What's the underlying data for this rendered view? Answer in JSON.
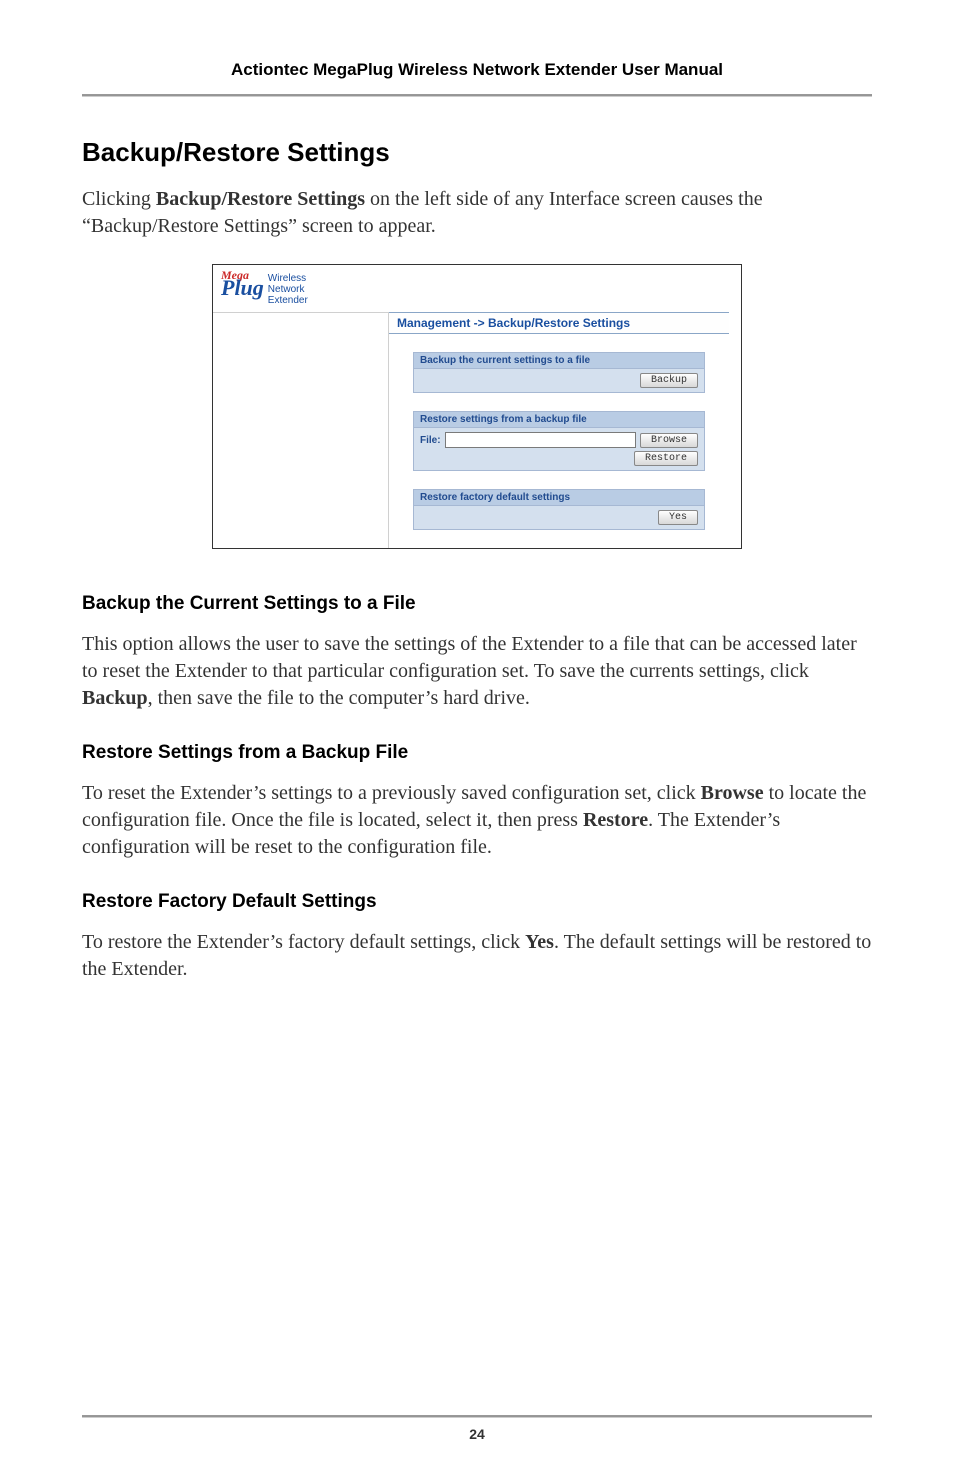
{
  "header": {
    "title": "Actiontec MegaPlug Wireless Network Extender User Manual"
  },
  "section": {
    "title": "Backup/Restore Settings",
    "intro_a": "Clicking ",
    "intro_bold": "Backup/Restore Settings",
    "intro_b": " on the left side of any Interface screen causes the “Backup/Restore Settings” screen to appear."
  },
  "screenshot": {
    "logo_mega": "Mega",
    "logo_plug": "Plug",
    "logo_sub1": "Wireless",
    "logo_sub2": "Network",
    "logo_sub3": "Extender",
    "breadcrumb": "Management -> Backup/Restore Settings",
    "panel1_title": "Backup the current settings to a file",
    "panel1_btn": "Backup",
    "panel2_title": "Restore settings from a backup file",
    "panel2_file_label": "File:",
    "panel2_browse": "Browse",
    "panel2_restore": "Restore",
    "panel3_title": "Restore factory default settings",
    "panel3_btn": "Yes"
  },
  "sub1": {
    "title": "Backup the Current Settings to a File",
    "text_a": "This option allows the user to save the settings of the Extender to a file that can be accessed later to reset the Extender to that particular configuration set. To save the currents settings, click ",
    "text_bold": "Backup",
    "text_b": ", then save the file to the computer’s hard drive."
  },
  "sub2": {
    "title": "Restore Settings from a Backup File",
    "text_a": "To reset the Extender’s settings to a previously saved configuration set, click ",
    "text_bold1": "Browse",
    "text_b": " to locate the configuration file. Once the file is located, select it, then press ",
    "text_bold2": "Restore",
    "text_c": ". The Extender’s configuration will be reset to the configuration file."
  },
  "sub3": {
    "title": "Restore Factory Default Settings",
    "text_a": "To restore the Extender’s factory default settings, click ",
    "text_bold": "Yes",
    "text_b": ". The default settings will be restored to the Extender."
  },
  "page_number": "24"
}
